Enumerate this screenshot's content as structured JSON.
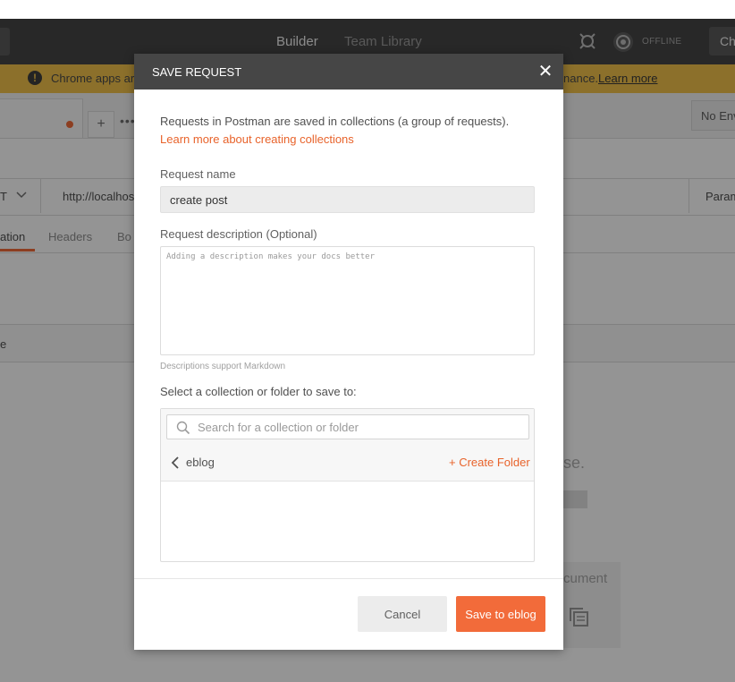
{
  "app": {
    "header": {
      "tabs": [
        {
          "label": "Builder"
        },
        {
          "label": "Team Library"
        }
      ],
      "status_label": "OFFLINE",
      "right_button_label": "Chi"
    },
    "banner": {
      "text_left": "Chrome apps are",
      "text_right": "nance.",
      "link_label": "Learn more"
    },
    "tabs_row": {
      "new_tab_label": "+",
      "more_label": "•••",
      "environment_label": "No Env"
    },
    "request": {
      "method": "T",
      "url": "http://localhos",
      "params_label": "Param"
    },
    "subtabs": [
      {
        "label": "ation"
      },
      {
        "label": "Headers"
      },
      {
        "label": "Bo"
      }
    ],
    "row2_text": "e",
    "response_text": "se.",
    "document_label": "cument"
  },
  "modal": {
    "title": "SAVE REQUEST",
    "close_symbol": "✕",
    "intro": "Requests in Postman are saved in collections (a group of requests).",
    "learn_link": "Learn more about creating collections",
    "name_label": "Request name",
    "name_value": "create post",
    "description_label": "Request description (Optional)",
    "description_placeholder": "Adding a description makes your docs better",
    "markdown_note": "Descriptions support Markdown",
    "collection_label": "Select a collection or folder to save to:",
    "search_placeholder": "Search for a collection or folder",
    "current_folder": "eblog",
    "create_folder_label": "+ Create Folder",
    "cancel_label": "Cancel",
    "save_label": "Save to eblog"
  },
  "colors": {
    "accent": "#f26b3a",
    "link": "#e8632b",
    "header_bg": "#464646",
    "banner_bg": "#f1c24a"
  }
}
